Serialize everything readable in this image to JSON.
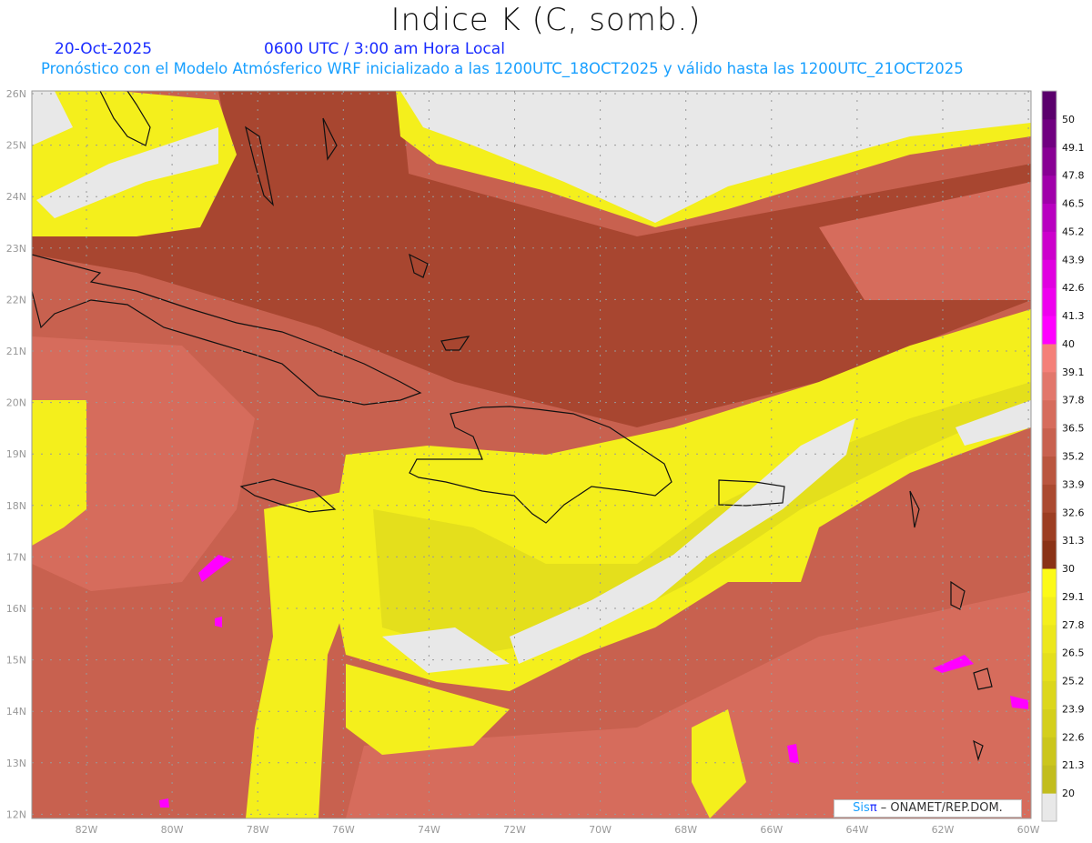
{
  "header": {
    "title": "Indice K (C, somb.)",
    "date": "20-Oct-2025",
    "time": "0600 UTC / 3:00 am Hora Local",
    "description": "Pronóstico con el Modelo Atmósferico WRF inicializado a las 1200UTC_18OCT2025 y válido hasta las  1200UTC_21OCT2025"
  },
  "map": {
    "lon_labels": [
      "82W",
      "80W",
      "78W",
      "76W",
      "74W",
      "72W",
      "70W",
      "68W",
      "66W",
      "64W",
      "62W",
      "60W"
    ],
    "lat_labels": [
      "26N",
      "25N",
      "24N",
      "23N",
      "22N",
      "21N",
      "20N",
      "19N",
      "18N",
      "17N",
      "16N",
      "15N",
      "14N",
      "13N",
      "12N"
    ],
    "grid": true
  },
  "colorbar": {
    "labels": [
      "20",
      "21.3",
      "22.6",
      "23.9",
      "25.2",
      "26.5",
      "27.8",
      "29.1",
      "30",
      "31.3",
      "32.6",
      "33.9",
      "35.2",
      "36.5",
      "37.8",
      "39.1",
      "40",
      "41.3",
      "42.6",
      "43.9",
      "45.2",
      "46.5",
      "47.8",
      "49.1",
      "50"
    ],
    "colors": [
      "#e8e8e8",
      "#c2bd1e",
      "#cbc61c",
      "#d4cf1c",
      "#dcd71c",
      "#e4df1c",
      "#ece71c",
      "#f4ef1c",
      "#fcfa18",
      "#8a3216",
      "#9c3e22",
      "#ab4a30",
      "#ba563f",
      "#c8614f",
      "#d66c5c",
      "#e2776b",
      "#f48078",
      "#ff00ff",
      "#ee00ee",
      "#e000e0",
      "#cc00cc",
      "#b800c0",
      "#a000aa",
      "#880094",
      "#700080",
      "#5a006c"
    ]
  },
  "footer": {
    "logo_sis": "Sis",
    "logo_pi": "π",
    "credit": "– ONAMET/REP.DOM."
  }
}
